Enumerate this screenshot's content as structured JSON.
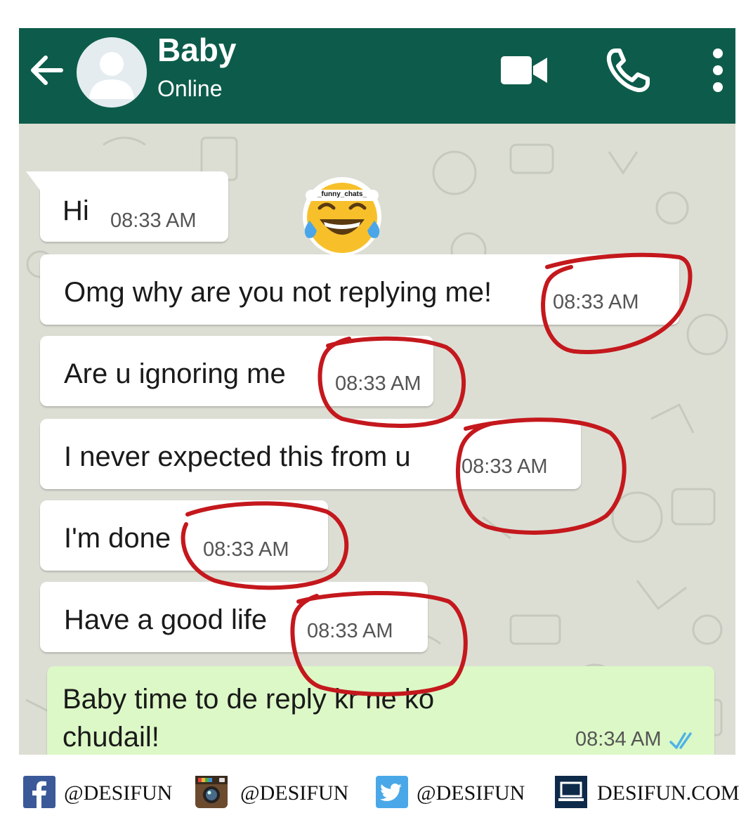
{
  "header": {
    "contact_name": "Baby",
    "contact_status": "Online",
    "icons": [
      "back-arrow-icon",
      "avatar-placeholder-icon",
      "video-call-icon",
      "phone-call-icon",
      "more-options-icon"
    ],
    "color": "#0d5c4b"
  },
  "messages": [
    {
      "text": "Hi",
      "time": "08:33 AM",
      "direction": "received"
    },
    {
      "text": "Omg why are you not replying me!",
      "time": "08:33 AM",
      "direction": "received"
    },
    {
      "text": "Are u ignoring me",
      "time": "08:33 AM",
      "direction": "received"
    },
    {
      "text": "I never expected this from u",
      "time": "08:33 AM",
      "direction": "received"
    },
    {
      "text": "I'm done",
      "time": "08:33 AM",
      "direction": "received"
    },
    {
      "text": "Have a good life",
      "time": "08:33 AM",
      "direction": "received"
    }
  ],
  "sent_message": {
    "line1": "Baby time to de reply kr ne ko",
    "line2": "chudail!",
    "time": "08:34 AM",
    "status_icon": "double-check-icon",
    "status_color": "#4fb3e6"
  },
  "sticker": {
    "label": "_funny_chats_",
    "icon": "laughing-tears-emoji-icon"
  },
  "colors": {
    "chat_background": "#dcded4",
    "received_bubble": "#ffffff",
    "sent_bubble": "#dcf8c6",
    "annotation_circle": "#c4181d"
  },
  "footer": {
    "facebook": "@DESIFUN",
    "instagram": "@DESIFUN",
    "twitter": "@DESIFUN",
    "website": "DESIFUN.COM"
  }
}
